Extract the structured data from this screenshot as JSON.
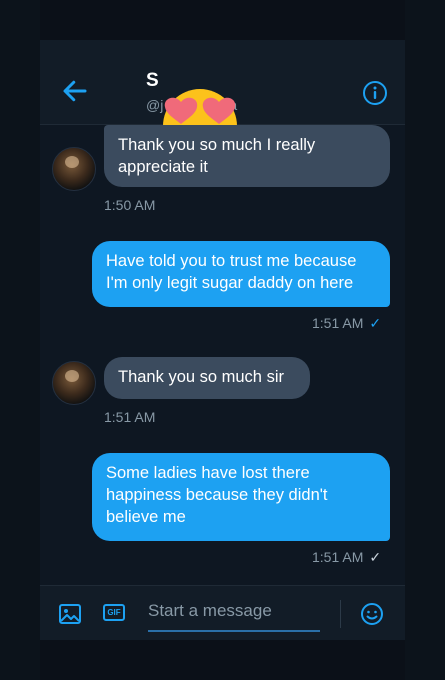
{
  "header": {
    "name": "S",
    "handle_start": "@j",
    "handle_end": "a"
  },
  "messages": [
    {
      "id": "m1",
      "direction": "in",
      "text": "Thank you so much I really appreciate it",
      "time": "1:50 AM"
    },
    {
      "id": "m2",
      "direction": "out",
      "text": "Have told you to trust me because I'm only legit sugar daddy on here",
      "time": "1:51 AM",
      "status": "✓"
    },
    {
      "id": "m3",
      "direction": "in",
      "text": "Thank you so much sir",
      "time": "1:51 AM"
    },
    {
      "id": "m4",
      "direction": "out",
      "text": "Some ladies have lost there happiness because they didn't believe me",
      "time": "1:51 AM",
      "status": "✓"
    }
  ],
  "composer": {
    "placeholder": "Start a message",
    "gif_label": "GIF"
  },
  "icons": {
    "back": "arrow-left-icon",
    "info": "info-icon",
    "image": "image-icon",
    "gif": "gif-icon",
    "emoji": "emoji-icon",
    "overlay": "heart-eyes-emoji"
  },
  "colors": {
    "accent": "#1da1f2",
    "incoming_bubble": "#3b4b5e",
    "background": "#0e1722"
  }
}
